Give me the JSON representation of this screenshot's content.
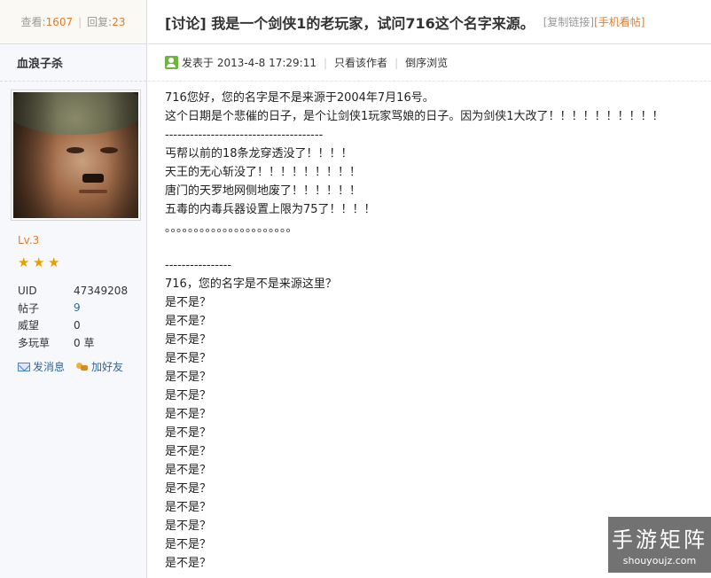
{
  "stats": {
    "views_label": "查看:",
    "views": "1607",
    "replies_label": "回复:",
    "replies": "23"
  },
  "author": {
    "username": "血浪子杀",
    "level": "Lv.3",
    "stars": [
      "★",
      "★",
      "★"
    ],
    "info": [
      {
        "key": "UID",
        "value": "47349208",
        "link": false
      },
      {
        "key": "帖子",
        "value": "9",
        "link": true
      },
      {
        "key": "威望",
        "value": "0",
        "link": false
      },
      {
        "key": "多玩草",
        "value": "0 草",
        "link": false
      }
    ],
    "actions": {
      "message": "发消息",
      "add_friend": "加好友"
    }
  },
  "thread": {
    "title": "[讨论] 我是一个剑侠1的老玩家，试问716这个名字来源。",
    "copy_link": "[复制链接]",
    "mobile_view": "[手机看帖]"
  },
  "meta": {
    "posted_label": "发表于 2013-4-8 17:29:11",
    "author_only": "只看该作者",
    "reverse_order": "倒序浏览"
  },
  "content": {
    "lines": [
      "716您好，您的名字是不是来源于2004年7月16号。",
      "这个日期是个悲催的日子，是个让剑侠1玩家骂娘的日子。因为剑侠1大改了！！！！！！！！！！",
      "--------------------------------------",
      "丐帮以前的18条龙穿透没了！！！！",
      "天王的无心斩没了！！！！！！！！！",
      "唐门的天罗地网侧地废了！！！！！！",
      "五毒的内毒兵器设置上限为75了！！！！",
      "。。。。。。。。。。。。。。。。。。。。。。",
      "",
      "----------------",
      "716，您的名字是不是来源这里？",
      "是不是？",
      "是不是？",
      "是不是？",
      "是不是？",
      "是不是？",
      "是不是？",
      "是不是？",
      "是不是？",
      "是不是？",
      "是不是？",
      "是不是？",
      "是不是？",
      "是不是？",
      "是不是？",
      "是不是？"
    ]
  },
  "watermark": {
    "title": "手游矩阵",
    "sub": "shouyoujz.com"
  }
}
